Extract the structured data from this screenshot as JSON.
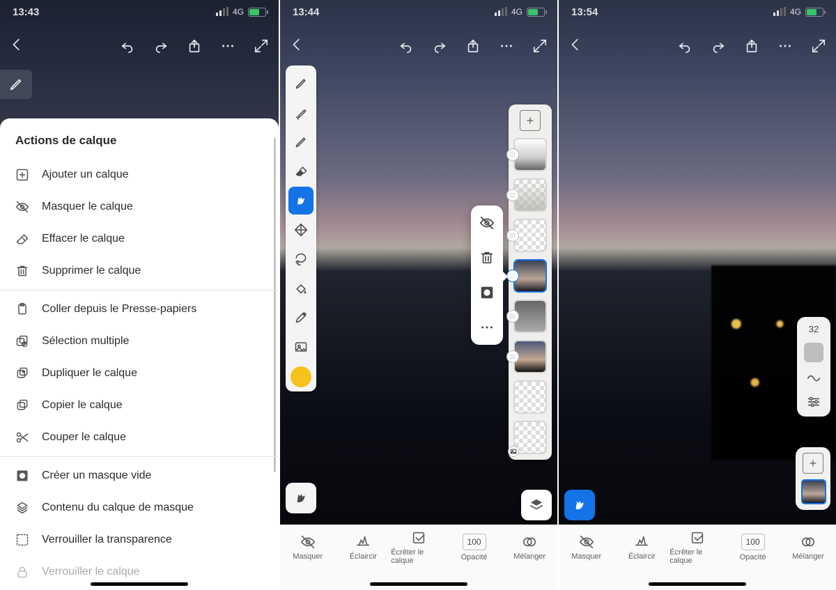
{
  "statusbar": {
    "t1": "13:43",
    "t2": "13:44",
    "t3": "13:54",
    "net": "4G"
  },
  "sheet": {
    "title": "Actions de calque",
    "groups": [
      [
        {
          "icon": "add",
          "label": "Ajouter un calque"
        },
        {
          "icon": "eye",
          "label": "Masquer le calque"
        },
        {
          "icon": "erase",
          "label": "Effacer le calque"
        },
        {
          "icon": "trash",
          "label": "Supprimer le calque"
        }
      ],
      [
        {
          "icon": "paste",
          "label": "Coller depuis le Presse-papiers"
        },
        {
          "icon": "multi",
          "label": "Sélection multiple"
        },
        {
          "icon": "dup",
          "label": "Dupliquer le calque"
        },
        {
          "icon": "copy",
          "label": "Copier le calque"
        },
        {
          "icon": "cut",
          "label": "Couper le calque"
        }
      ],
      [
        {
          "icon": "mask",
          "label": "Créer un masque vide"
        },
        {
          "icon": "mcont",
          "label": "Contenu du calque de masque"
        },
        {
          "icon": "locka",
          "label": "Verrouiller la transparence"
        },
        {
          "icon": "lock",
          "label": "Verrouiller le calque"
        }
      ]
    ]
  },
  "bottombar": {
    "hide": "Masquer",
    "lighten": "Éclaircir",
    "crop": "Écrêter le calque",
    "opacity": "Opacité",
    "opacityVal": "100",
    "blend": "Mélanger"
  },
  "slider": {
    "value": "32"
  }
}
